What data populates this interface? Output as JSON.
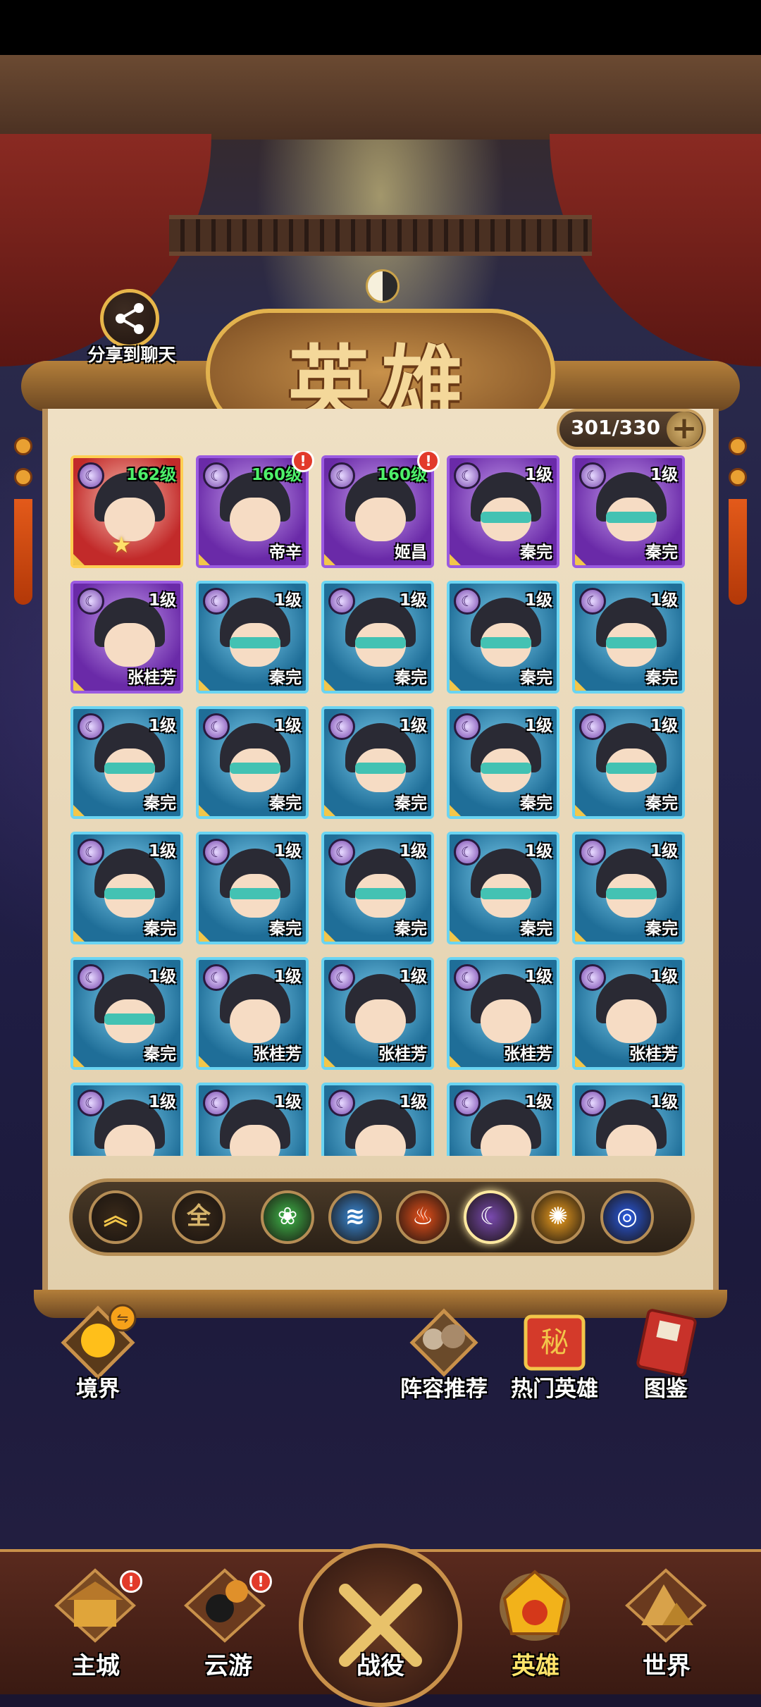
{
  "header": {
    "share_label": "分享到聊天",
    "title": "英雄",
    "count": "301/330",
    "plus_label": "+"
  },
  "heroes": [
    {
      "level": "162级",
      "name": "",
      "rarity": "red",
      "star": true
    },
    {
      "level": "160级",
      "name": "帝辛",
      "rarity": "purple",
      "alert": true
    },
    {
      "level": "160级",
      "name": "姬昌",
      "rarity": "purple",
      "alert": true
    },
    {
      "level": "1级",
      "name": "秦完",
      "rarity": "purple"
    },
    {
      "level": "1级",
      "name": "秦完",
      "rarity": "purple"
    },
    {
      "level": "1级",
      "name": "张桂芳",
      "rarity": "purple"
    },
    {
      "level": "1级",
      "name": "秦完",
      "rarity": "blue"
    },
    {
      "level": "1级",
      "name": "秦完",
      "rarity": "blue"
    },
    {
      "level": "1级",
      "name": "秦完",
      "rarity": "blue"
    },
    {
      "level": "1级",
      "name": "秦完",
      "rarity": "blue"
    },
    {
      "level": "1级",
      "name": "秦完",
      "rarity": "blue"
    },
    {
      "level": "1级",
      "name": "秦完",
      "rarity": "blue"
    },
    {
      "level": "1级",
      "name": "秦完",
      "rarity": "blue"
    },
    {
      "level": "1级",
      "name": "秦完",
      "rarity": "blue"
    },
    {
      "level": "1级",
      "name": "秦完",
      "rarity": "blue"
    },
    {
      "level": "1级",
      "name": "秦完",
      "rarity": "blue"
    },
    {
      "level": "1级",
      "name": "秦完",
      "rarity": "blue"
    },
    {
      "level": "1级",
      "name": "秦完",
      "rarity": "blue"
    },
    {
      "level": "1级",
      "name": "秦完",
      "rarity": "blue"
    },
    {
      "level": "1级",
      "name": "秦完",
      "rarity": "blue"
    },
    {
      "level": "1级",
      "name": "秦完",
      "rarity": "blue"
    },
    {
      "level": "1级",
      "name": "张桂芳",
      "rarity": "blue"
    },
    {
      "level": "1级",
      "name": "张桂芳",
      "rarity": "blue"
    },
    {
      "level": "1级",
      "name": "张桂芳",
      "rarity": "blue"
    },
    {
      "level": "1级",
      "name": "张桂芳",
      "rarity": "blue"
    },
    {
      "level": "1级",
      "name": "",
      "rarity": "blue"
    },
    {
      "level": "1级",
      "name": "",
      "rarity": "blue"
    },
    {
      "level": "1级",
      "name": "",
      "rarity": "blue"
    },
    {
      "level": "1级",
      "name": "",
      "rarity": "blue"
    },
    {
      "level": "1级",
      "name": "",
      "rarity": "blue"
    }
  ],
  "filters": [
    {
      "name": "rank-sort",
      "label": "︽",
      "color": "#f2c64a"
    },
    {
      "name": "all",
      "label": "全",
      "color": "#d6b46a"
    },
    {
      "name": "wood",
      "label": "❀",
      "color": "#3fb84a"
    },
    {
      "name": "water",
      "label": "≋",
      "color": "#3a8ad8"
    },
    {
      "name": "fire",
      "label": "♨",
      "color": "#e8501a"
    },
    {
      "name": "dark",
      "label": "☾",
      "color": "#7a4ab0",
      "selected": true
    },
    {
      "name": "light",
      "label": "✺",
      "color": "#f0a020"
    },
    {
      "name": "wind",
      "label": "◎",
      "color": "#2a5ae0"
    }
  ],
  "actions": {
    "realm": "境界",
    "lineup": "阵容推荐",
    "popular": "热门英雄",
    "codex": "图鉴"
  },
  "nav": {
    "main_city": "主城",
    "travel": "云游",
    "battle": "战役",
    "heroes": "英雄",
    "world": "世界"
  },
  "colors": {
    "accent_gold": "#e7b64a",
    "active_tab": "#ffe46a",
    "alert_red": "#e23a2a"
  }
}
